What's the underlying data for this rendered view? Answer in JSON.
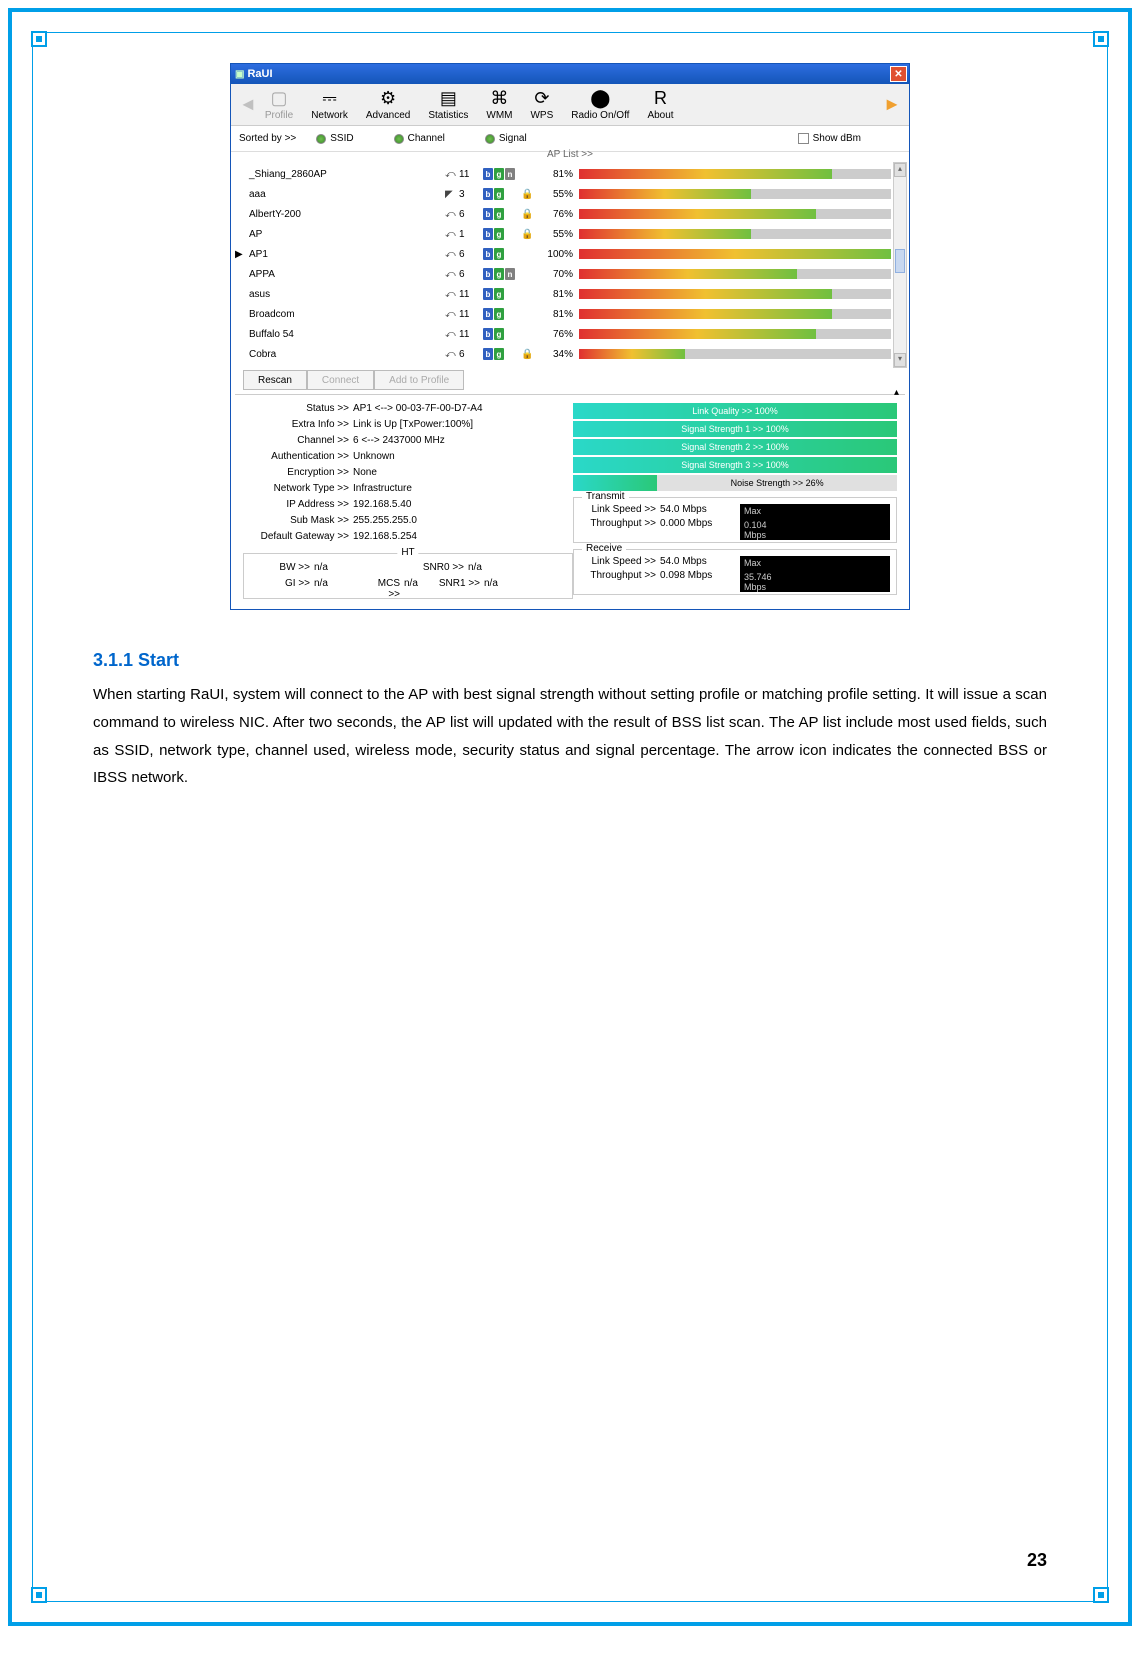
{
  "window": {
    "title": "RaUI"
  },
  "toolbar": {
    "items": [
      {
        "label": "Profile",
        "enabled": false
      },
      {
        "label": "Network",
        "enabled": true
      },
      {
        "label": "Advanced",
        "enabled": true
      },
      {
        "label": "Statistics",
        "enabled": true
      },
      {
        "label": "WMM",
        "enabled": true
      },
      {
        "label": "WPS",
        "enabled": true
      },
      {
        "label": "Radio On/Off",
        "enabled": true
      },
      {
        "label": "About",
        "enabled": true
      }
    ]
  },
  "sort": {
    "label": "Sorted by >>",
    "options": [
      "SSID",
      "Channel",
      "Signal"
    ],
    "selected": "SSID",
    "show_dbm": "Show dBm",
    "ap_list": "AP List >>"
  },
  "ap_rows": [
    {
      "ssid": "_Shiang_2860AP",
      "ch": "11",
      "modes": [
        "b",
        "g",
        "n"
      ],
      "secure": false,
      "pct": 81
    },
    {
      "ssid": "aaa",
      "ch": "3",
      "ch_icon": "ad",
      "modes": [
        "b",
        "g"
      ],
      "secure": true,
      "pct": 55
    },
    {
      "ssid": "AlbertY-200",
      "ch": "6",
      "modes": [
        "b",
        "g"
      ],
      "secure": true,
      "pct": 76
    },
    {
      "ssid": "AP",
      "ch": "1",
      "modes": [
        "b",
        "g"
      ],
      "secure": true,
      "pct": 55
    },
    {
      "ssid": "AP1",
      "ch": "6",
      "modes": [
        "b",
        "g"
      ],
      "secure": false,
      "pct": 100,
      "connected": true
    },
    {
      "ssid": "APPA",
      "ch": "6",
      "modes": [
        "b",
        "g",
        "n"
      ],
      "secure": false,
      "pct": 70
    },
    {
      "ssid": "asus",
      "ch": "11",
      "modes": [
        "b",
        "g"
      ],
      "secure": false,
      "pct": 81
    },
    {
      "ssid": "Broadcom",
      "ch": "11",
      "modes": [
        "b",
        "g"
      ],
      "secure": false,
      "pct": 81
    },
    {
      "ssid": "Buffalo 54",
      "ch": "11",
      "modes": [
        "b",
        "g"
      ],
      "secure": false,
      "pct": 76
    },
    {
      "ssid": "Cobra",
      "ch": "6",
      "modes": [
        "b",
        "g"
      ],
      "secure": true,
      "pct": 34
    }
  ],
  "buttons": {
    "rescan": "Rescan",
    "connect": "Connect",
    "add_profile": "Add to Profile"
  },
  "status": {
    "items": [
      {
        "k": "Status >>",
        "v": "AP1 <--> 00-03-7F-00-D7-A4"
      },
      {
        "k": "Extra Info >>",
        "v": "Link is Up [TxPower:100%]"
      },
      {
        "k": "Channel >>",
        "v": "6 <--> 2437000 MHz"
      },
      {
        "k": "Authentication >>",
        "v": "Unknown"
      },
      {
        "k": "Encryption >>",
        "v": "None"
      },
      {
        "k": "Network Type >>",
        "v": "Infrastructure"
      },
      {
        "k": "IP Address >>",
        "v": "192.168.5.40"
      },
      {
        "k": "Sub Mask >>",
        "v": "255.255.255.0"
      },
      {
        "k": "Default Gateway >>",
        "v": "192.168.5.254"
      }
    ],
    "ht": {
      "legend": "HT",
      "bw": {
        "k": "BW >>",
        "v": "n/a"
      },
      "gi": {
        "k": "GI >>",
        "v": "n/a"
      },
      "mcs": {
        "k": "MCS >>",
        "v": "n/a"
      },
      "snr0": {
        "k": "SNR0 >>",
        "v": "n/a"
      },
      "snr1": {
        "k": "SNR1 >>",
        "v": "n/a"
      }
    }
  },
  "quality": {
    "bars": [
      "Link Quality >> 100%",
      "Signal Strength 1 >> 100%",
      "Signal Strength 2 >> 100%",
      "Signal Strength 3 >> 100%"
    ],
    "noise_label": "Noise Strength >> 26%"
  },
  "transmit": {
    "legend": "Transmit",
    "link_speed": {
      "k": "Link Speed >>",
      "v": "54.0 Mbps"
    },
    "throughput": {
      "k": "Throughput >>",
      "v": "0.000 Mbps"
    },
    "box": {
      "max": "Max",
      "val": "0.104",
      "unit": "Mbps"
    }
  },
  "receive": {
    "legend": "Receive",
    "link_speed": {
      "k": "Link Speed >>",
      "v": "54.0 Mbps"
    },
    "throughput": {
      "k": "Throughput >>",
      "v": "0.098 Mbps"
    },
    "box": {
      "max": "Max",
      "val": "35.746",
      "unit": "Mbps"
    }
  },
  "doc": {
    "heading": "3.1.1   Start",
    "para": "When starting RaUI, system will connect to the AP with best signal strength without setting profile or matching profile setting. It will issue a scan command to wireless NIC. After two seconds, the AP list will updated with the result of BSS list scan. The AP list include most used fields, such as SSID, network type, channel used, wireless mode, security status and signal percentage. The arrow icon indicates the connected BSS or IBSS network.",
    "page": "23"
  }
}
